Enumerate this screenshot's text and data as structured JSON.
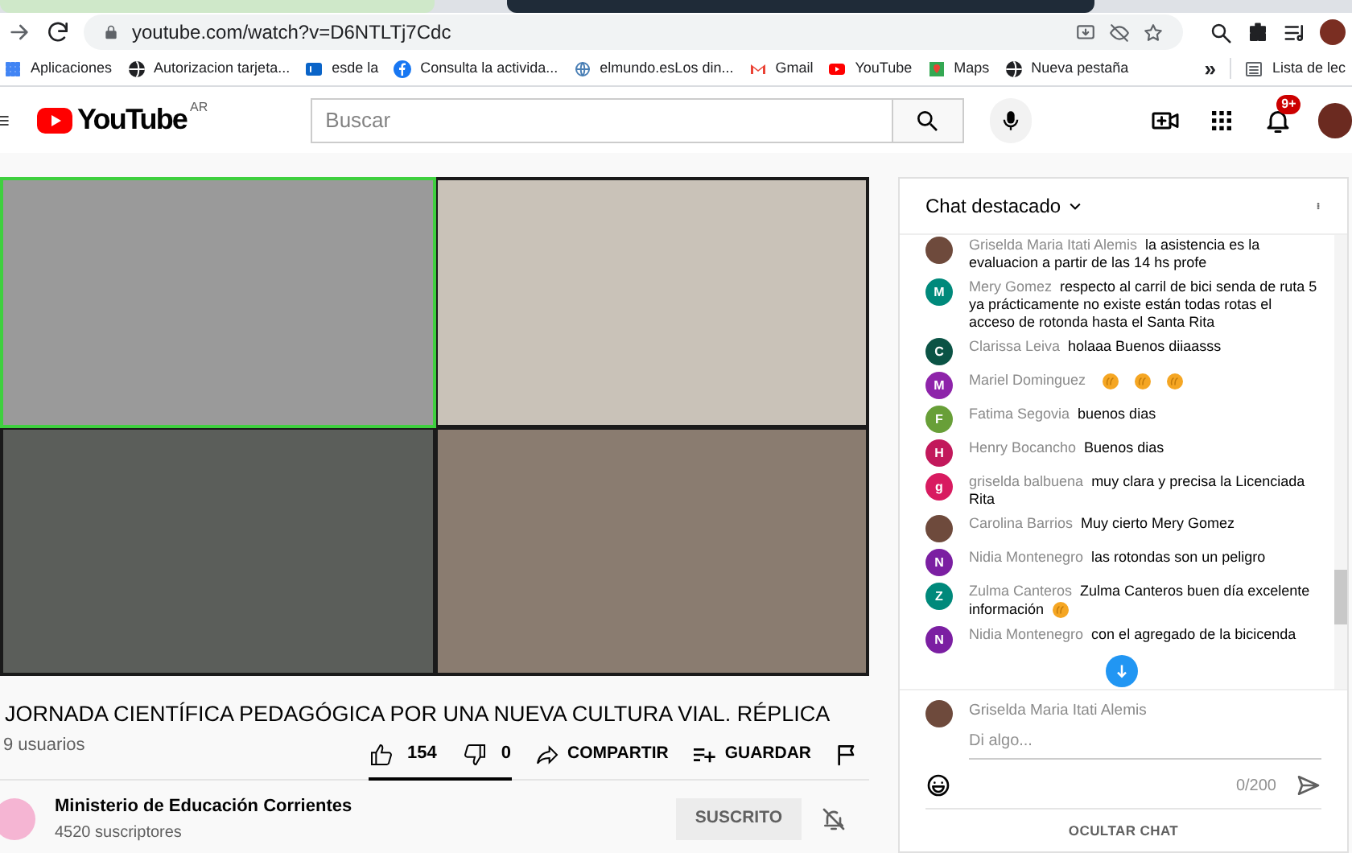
{
  "browser": {
    "address": "youtube.com/watch?v=D6NTLTj7Cdc",
    "bookmarks": [
      {
        "label": "Aplicaciones"
      },
      {
        "label": "Autorizacion tarjeta..."
      },
      {
        "label": "esde la"
      },
      {
        "label": "Consulta la activida..."
      },
      {
        "label": "elmundo.esLos din..."
      },
      {
        "label": "Gmail"
      },
      {
        "label": "YouTube"
      },
      {
        "label": "Maps"
      },
      {
        "label": "Nueva pestaña"
      }
    ],
    "more": "»",
    "reading_list": "Lista de lec"
  },
  "header": {
    "logo": "YouTube",
    "country": "AR",
    "search": {
      "placeholder": "Buscar"
    },
    "notifications": "9+"
  },
  "video": {
    "title": "JORNADA CIENTÍFICA PEDAGÓGICA POR UNA NUEVA CULTURA VIAL. RÉPLICA",
    "viewers": "9 usuarios",
    "likes": "154",
    "dislikes": "0",
    "sentiment": {
      "level": 1
    },
    "share": "COMPARTIR",
    "save": "GUARDAR"
  },
  "channel": {
    "name": "Ministerio de Educación Corrientes",
    "subscribers": "4520 suscriptores",
    "subscribe": "SUSCRITO"
  },
  "chat": {
    "title": "Chat destacado",
    "messages": [
      {
        "author": "Griselda Maria Itati Alemis",
        "text": "la asistencia es la evaluacion a partir de las 14 hs profe",
        "avatar": {
          "kind": "photo"
        }
      },
      {
        "author": "Mery Gomez",
        "text": "respecto al carril de bici senda de ruta 5 ya prácticamente no existe están todas rotas el acceso de rotonda hasta el Santa Rita",
        "avatar": {
          "kind": "letter",
          "initial": "M",
          "color": "#00897b"
        }
      },
      {
        "author": "Clarissa Leiva",
        "text": "holaaa Buenos diiaasss",
        "avatar": {
          "kind": "letter",
          "initial": "C",
          "color": "#0b5345"
        }
      },
      {
        "author": "Mariel Dominguez",
        "reactions": [
          {
            "kind": "wave"
          },
          {
            "kind": "wave"
          },
          {
            "kind": "wave"
          }
        ],
        "avatar": {
          "kind": "letter",
          "initial": "M",
          "color": "#8e24aa"
        }
      },
      {
        "author": "Fatima Segovia",
        "text": "buenos dias",
        "avatar": {
          "kind": "letter",
          "initial": "F",
          "color": "#689f38"
        }
      },
      {
        "author": "Henry Bocancho",
        "text": "Buenos dias",
        "avatar": {
          "kind": "letter",
          "initial": "H",
          "color": "#c2185b"
        }
      },
      {
        "author": "griselda balbuena",
        "text": "muy clara y precisa la Licenciada Rita",
        "avatar": {
          "kind": "letter",
          "initial": "g",
          "color": "#d81b60"
        }
      },
      {
        "author": "Carolina Barrios",
        "text": "Muy cierto Mery Gomez",
        "avatar": {
          "kind": "photo"
        }
      },
      {
        "author": "Nidia Montenegro",
        "text": "las rotondas son un peligro",
        "avatar": {
          "kind": "letter",
          "initial": "N",
          "color": "#7b1fa2"
        }
      },
      {
        "author": "Zulma Canteros",
        "text": "Zulma Canteros buen día excelente información",
        "reactions": [
          {
            "kind": "wave"
          }
        ],
        "avatar": {
          "kind": "letter",
          "initial": "Z",
          "color": "#00897b"
        }
      },
      {
        "author": "Nidia Montenegro",
        "text": "con el agregado de la bicicenda",
        "avatar": {
          "kind": "letter",
          "initial": "N",
          "color": "#7b1fa2"
        }
      }
    ],
    "composer": {
      "author": "Griselda Maria Itati Alemis",
      "placeholder": "Di algo...",
      "counter": "0/200"
    },
    "hide": "OCULTAR CHAT"
  }
}
